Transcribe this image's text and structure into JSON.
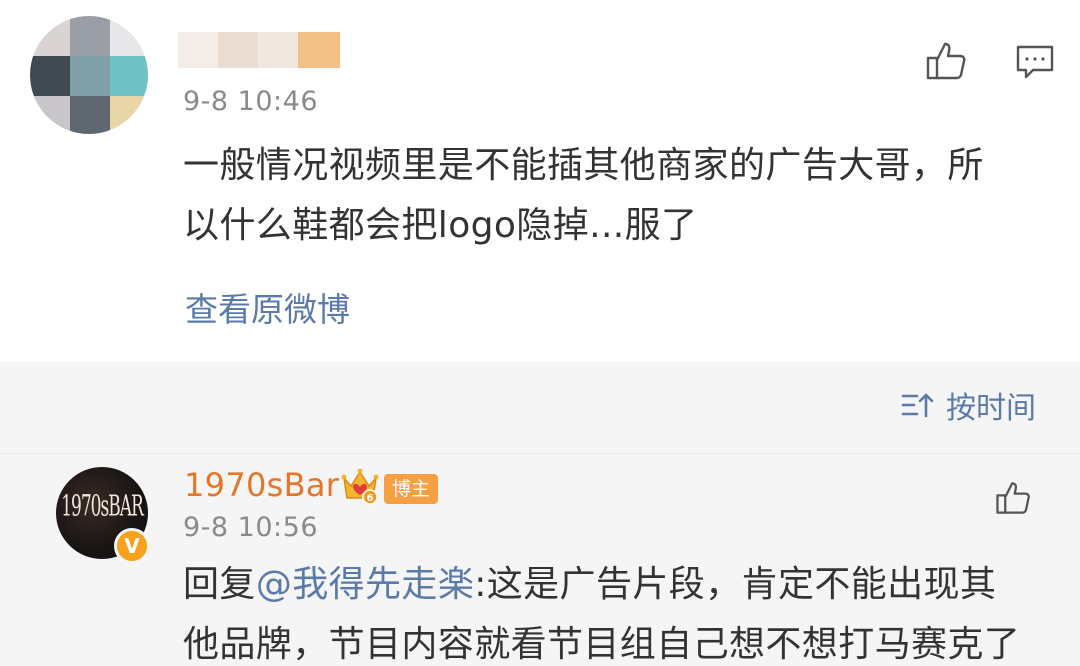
{
  "post": {
    "time": "9-8 10:46",
    "text_line1": "一般情况视频里是不能插其他商家的广告大哥，所",
    "text_line2": "以什么鞋都会把logo隐掉...服了",
    "view_original_label": "查看原微博"
  },
  "sort": {
    "label": "按时间",
    "icon": "sort-icon"
  },
  "reply": {
    "avatar_text": "1970sBAR",
    "verified_mark": "V",
    "username": "1970sBar",
    "crown_level": "6",
    "badge_label": "博主",
    "time": "9-8 10:56",
    "prefix": "回复",
    "mention": "@我得先走楽",
    "text_line1_rest": ":这是广告片段，肯定不能出现其",
    "text_line2": "他品牌，节目内容就看节目组自己想不想打马赛克了"
  },
  "icons": {
    "like": "thumbs-up-icon",
    "comment": "comment-icon",
    "crown": "crown-icon"
  },
  "colors": {
    "link": "#5b7aa8",
    "username": "#e2772b",
    "badge": "#f7a043",
    "verify": "#f6a21b",
    "meta": "#8a8a8a"
  }
}
